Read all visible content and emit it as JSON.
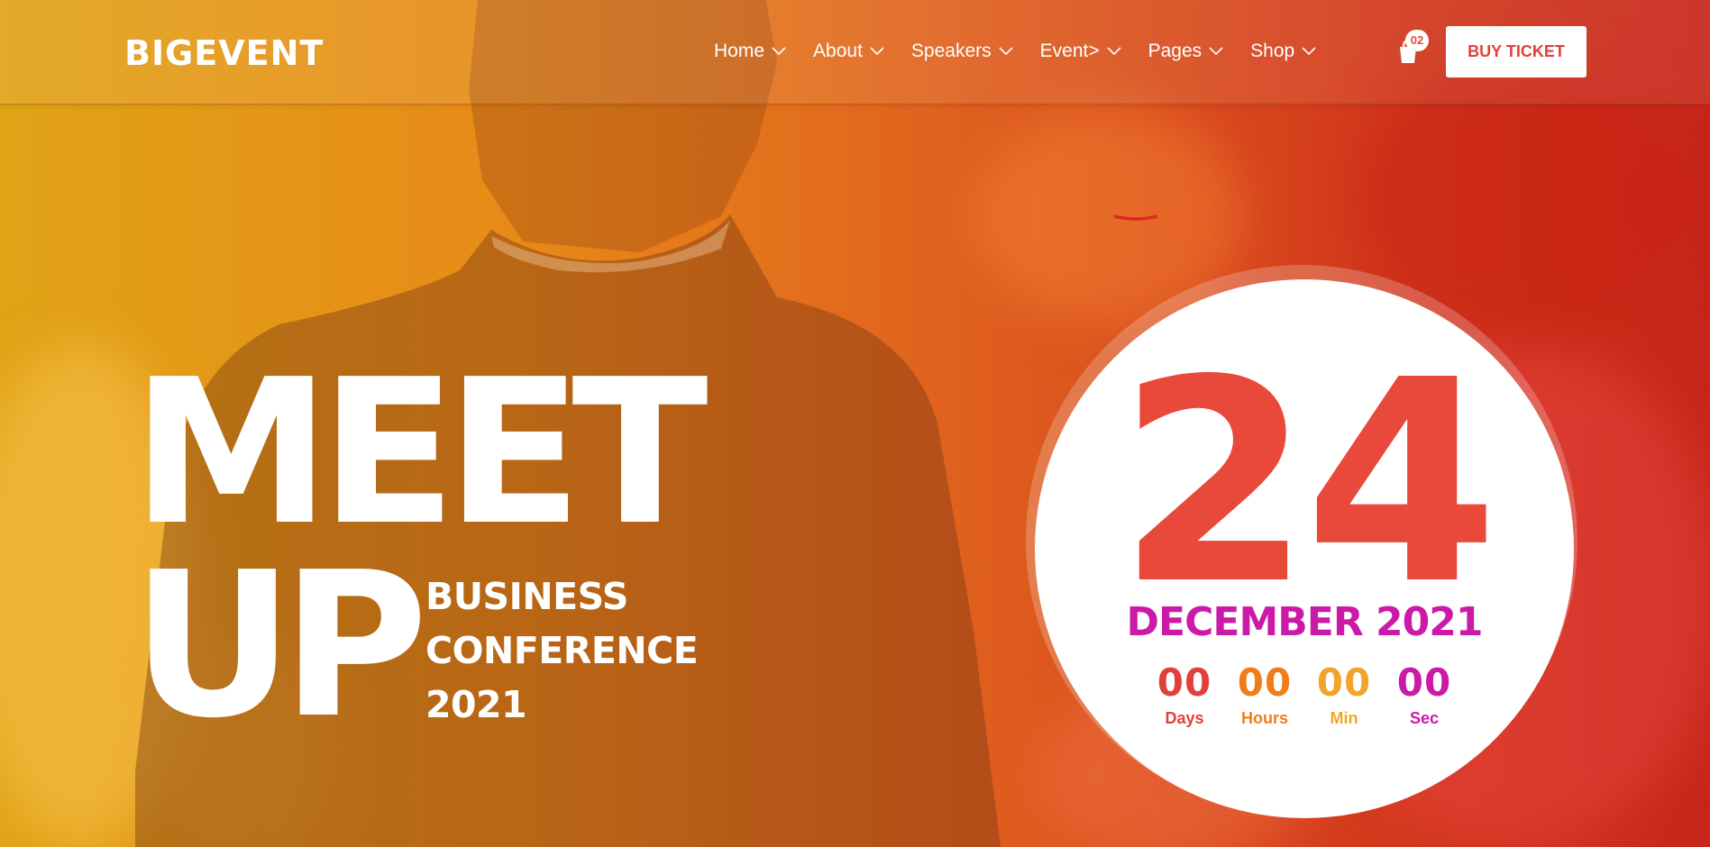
{
  "brand": {
    "logo_text": "BIGEVENT"
  },
  "nav": {
    "items": [
      {
        "label": "Home"
      },
      {
        "label": "About"
      },
      {
        "label": "Speakers"
      },
      {
        "label": "Event>"
      },
      {
        "label": "Pages"
      },
      {
        "label": "Shop"
      }
    ],
    "cart_count": "02",
    "buy_ticket_label": "BUY TICKET"
  },
  "hero": {
    "title_line1": "MEET",
    "title_line2": "UP",
    "subtitle": [
      "BUSINESS",
      "CONFERENCE",
      "2021"
    ]
  },
  "event_date": {
    "day": "24",
    "month_year": "DECEMBER 2021",
    "countdown": [
      {
        "value": "00",
        "label": "Days",
        "color": "#e2413a"
      },
      {
        "value": "00",
        "label": "Hours",
        "color": "#f07d1a"
      },
      {
        "value": "00",
        "label": "Min",
        "color": "#f0a52a"
      },
      {
        "value": "00",
        "label": "Sec",
        "color": "#cc1aa8"
      }
    ]
  },
  "colors": {
    "accent_red": "#e8493b",
    "accent_magenta": "#cc1aa8",
    "gradient_start": "#e0a316",
    "gradient_end": "#c72618"
  },
  "icons": [
    "chevron-down-icon",
    "cart-icon"
  ]
}
